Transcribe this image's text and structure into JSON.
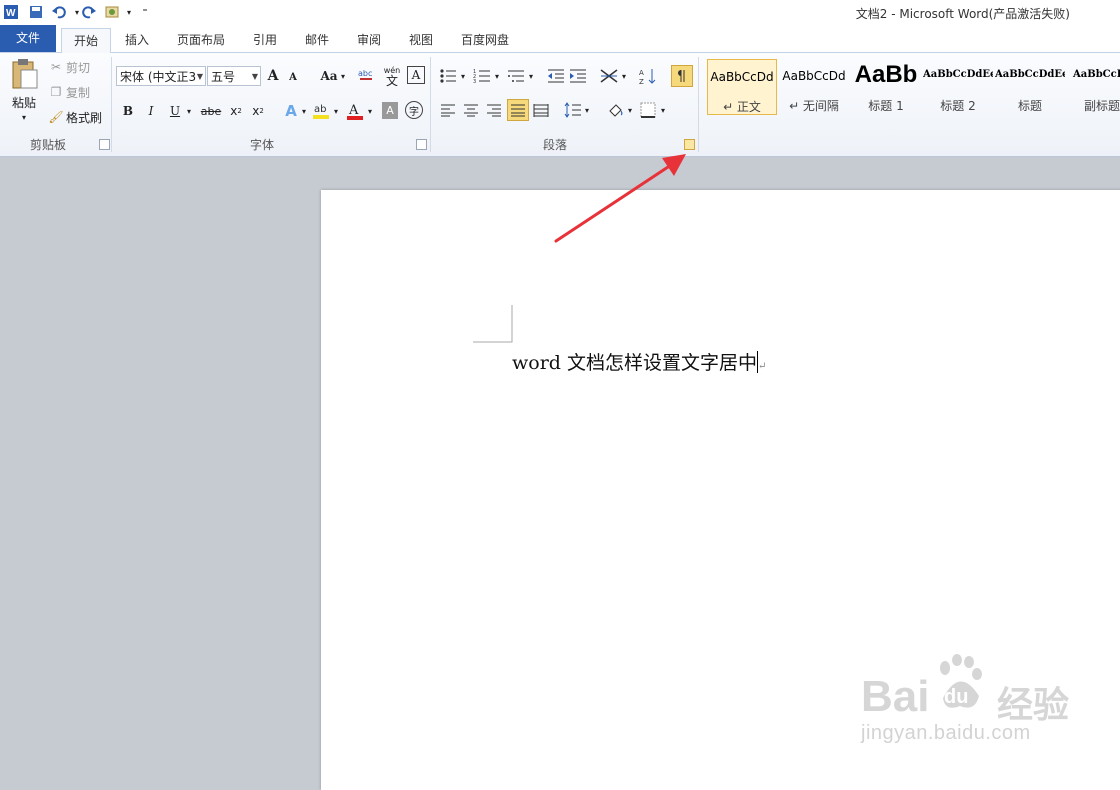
{
  "window": {
    "title": "文档2 - Microsoft Word(产品激活失败)"
  },
  "quick_access": {
    "icons": [
      "word-logo-icon",
      "save-icon",
      "undo-icon",
      "redo-icon",
      "customize-icon"
    ]
  },
  "tabs": [
    {
      "label": "文件"
    },
    {
      "label": "开始"
    },
    {
      "label": "插入"
    },
    {
      "label": "页面布局"
    },
    {
      "label": "引用"
    },
    {
      "label": "邮件"
    },
    {
      "label": "审阅"
    },
    {
      "label": "视图"
    },
    {
      "label": "百度网盘"
    }
  ],
  "clipboard": {
    "paste": "粘贴",
    "cut": "剪切",
    "copy": "复制",
    "format_painter": "格式刷",
    "label": "剪贴板"
  },
  "font": {
    "name": "宋体 (中文正3",
    "size": "五号",
    "label": "字体",
    "aa": "Aa",
    "grow": "A",
    "shrink": "A",
    "bold": "B",
    "italic": "I",
    "underline": "U",
    "strike": "abe",
    "sub": "x",
    "sup": "x",
    "sub2": "2",
    "sup2": "2",
    "color_a": "A",
    "wen": "wén",
    "wen_ch": "文",
    "clear": "A",
    "phon": "字"
  },
  "paragraph": {
    "label": "段落"
  },
  "styles": [
    {
      "sample": "AaBbCcDd",
      "name": "↵ 正文"
    },
    {
      "sample": "AaBbCcDd",
      "name": "↵ 无间隔"
    },
    {
      "sample": "AaBb",
      "name": "标题 1"
    },
    {
      "sample": "AaBbCcDdEe",
      "name": "标题 2"
    },
    {
      "sample": "AaBbCcDdEe",
      "name": "标题"
    },
    {
      "sample": "AaBbCcDd",
      "name": "副标题"
    }
  ],
  "document": {
    "text": "word 文档怎样设置文字居中",
    "mark": "↵"
  },
  "watermark": {
    "brand": "Bai",
    "paw": "du",
    "cn": "经验",
    "url": "jingyan.baidu.com"
  },
  "colors": {
    "file_tab": "#2a5db0",
    "arrow": "#e8323a",
    "highlight": "#f5d97a"
  }
}
